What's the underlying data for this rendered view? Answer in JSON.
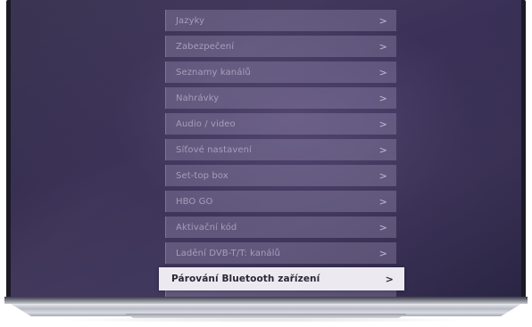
{
  "menu": {
    "items": [
      {
        "label": "Jazyky",
        "chevron": ">"
      },
      {
        "label": "Zabezpečení",
        "chevron": ">"
      },
      {
        "label": "Seznamy kanálů",
        "chevron": ">"
      },
      {
        "label": "Nahrávky",
        "chevron": ">"
      },
      {
        "label": "Audio / video",
        "chevron": ">"
      },
      {
        "label": "Síťové nastavení",
        "chevron": ">"
      },
      {
        "label": "Set-top box",
        "chevron": ">"
      },
      {
        "label": "HBO GO",
        "chevron": ">"
      },
      {
        "label": "Aktivační kód",
        "chevron": ">"
      },
      {
        "label": "Ladění DVB-T/T: kanálů",
        "chevron": ">"
      }
    ],
    "selected": {
      "label": "Párování Bluetooth zařízení",
      "chevron": ">"
    }
  },
  "colors": {
    "screen_bg": "#3a3158",
    "item_bg": "#968caf",
    "selected_bg": "#eceaf0",
    "selected_text": "#2a2636"
  }
}
